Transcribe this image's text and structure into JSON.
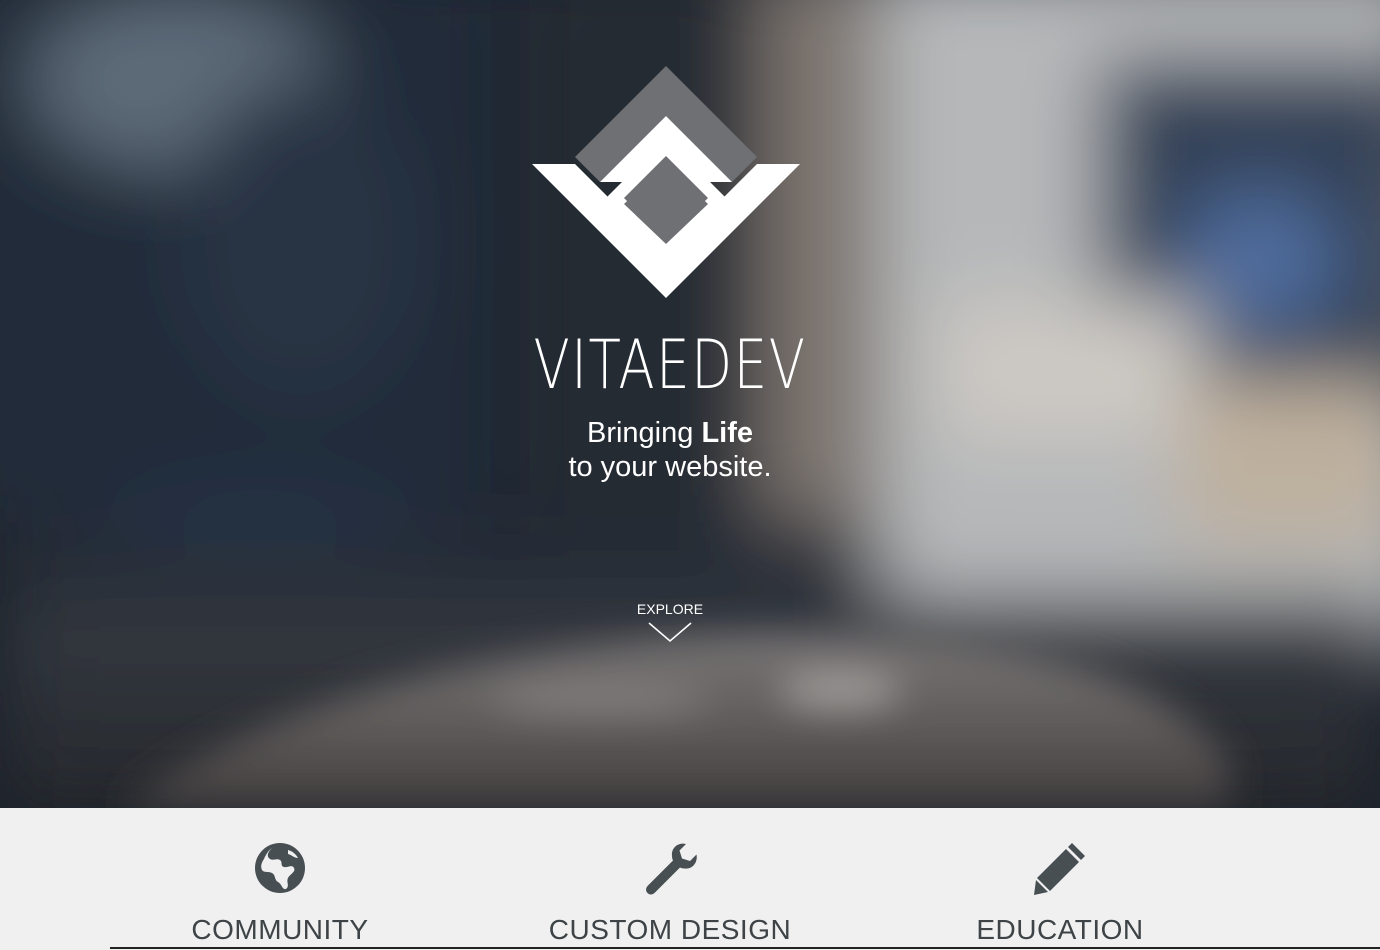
{
  "hero": {
    "brand": "VITAEDEV",
    "tagline_line1_prefix": "Bringing ",
    "tagline_line1_bold": "Life",
    "tagline_line2": "to your website.",
    "explore_label": "EXPLORE",
    "logo_icon": "diamond-logo-icon",
    "explore_icon": "chevron-down-icon"
  },
  "features": [
    {
      "label": "COMMUNITY",
      "icon": "globe-icon"
    },
    {
      "label": "CUSTOM DESIGN",
      "icon": "wrench-icon"
    },
    {
      "label": "EDUCATION",
      "icon": "pencil-icon"
    }
  ],
  "colors": {
    "feature_bg": "#f0f0f0",
    "feature_text": "#3d4346",
    "icon_color": "#474f53",
    "logo_gray": "#6f7074",
    "logo_white": "#ffffff"
  }
}
